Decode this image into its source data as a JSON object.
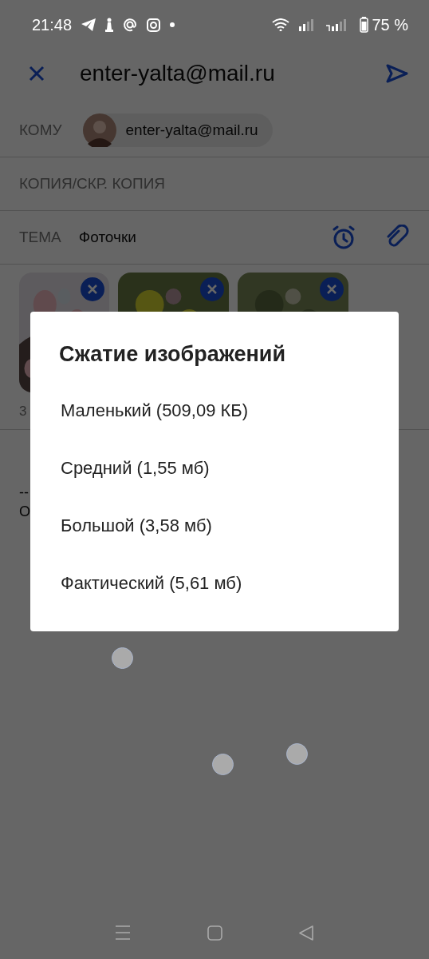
{
  "status_bar": {
    "time": "21:48",
    "battery": "75 %"
  },
  "header": {
    "title": "enter-yalta@mail.ru"
  },
  "to": {
    "label": "КОМУ",
    "recipient": "enter-yalta@mail.ru"
  },
  "cc": {
    "label": "КОПИЯ/СКР. КОПИЯ"
  },
  "subject": {
    "label": "ТЕМА",
    "value": "Фоточки"
  },
  "attachments": [
    {
      "kind": "picture"
    },
    {
      "kind": "picture"
    },
    {
      "kind": "picture"
    }
  ],
  "attachments_summary": "3",
  "signature": [
    "--",
    "О"
  ],
  "dialog": {
    "title": "Сжатие изображений",
    "options": [
      "Маленький (509,09 КБ)",
      "Средний (1,55 мб)",
      "Большой (3,58 мб)",
      "Фактический (5,61 мб)"
    ]
  }
}
